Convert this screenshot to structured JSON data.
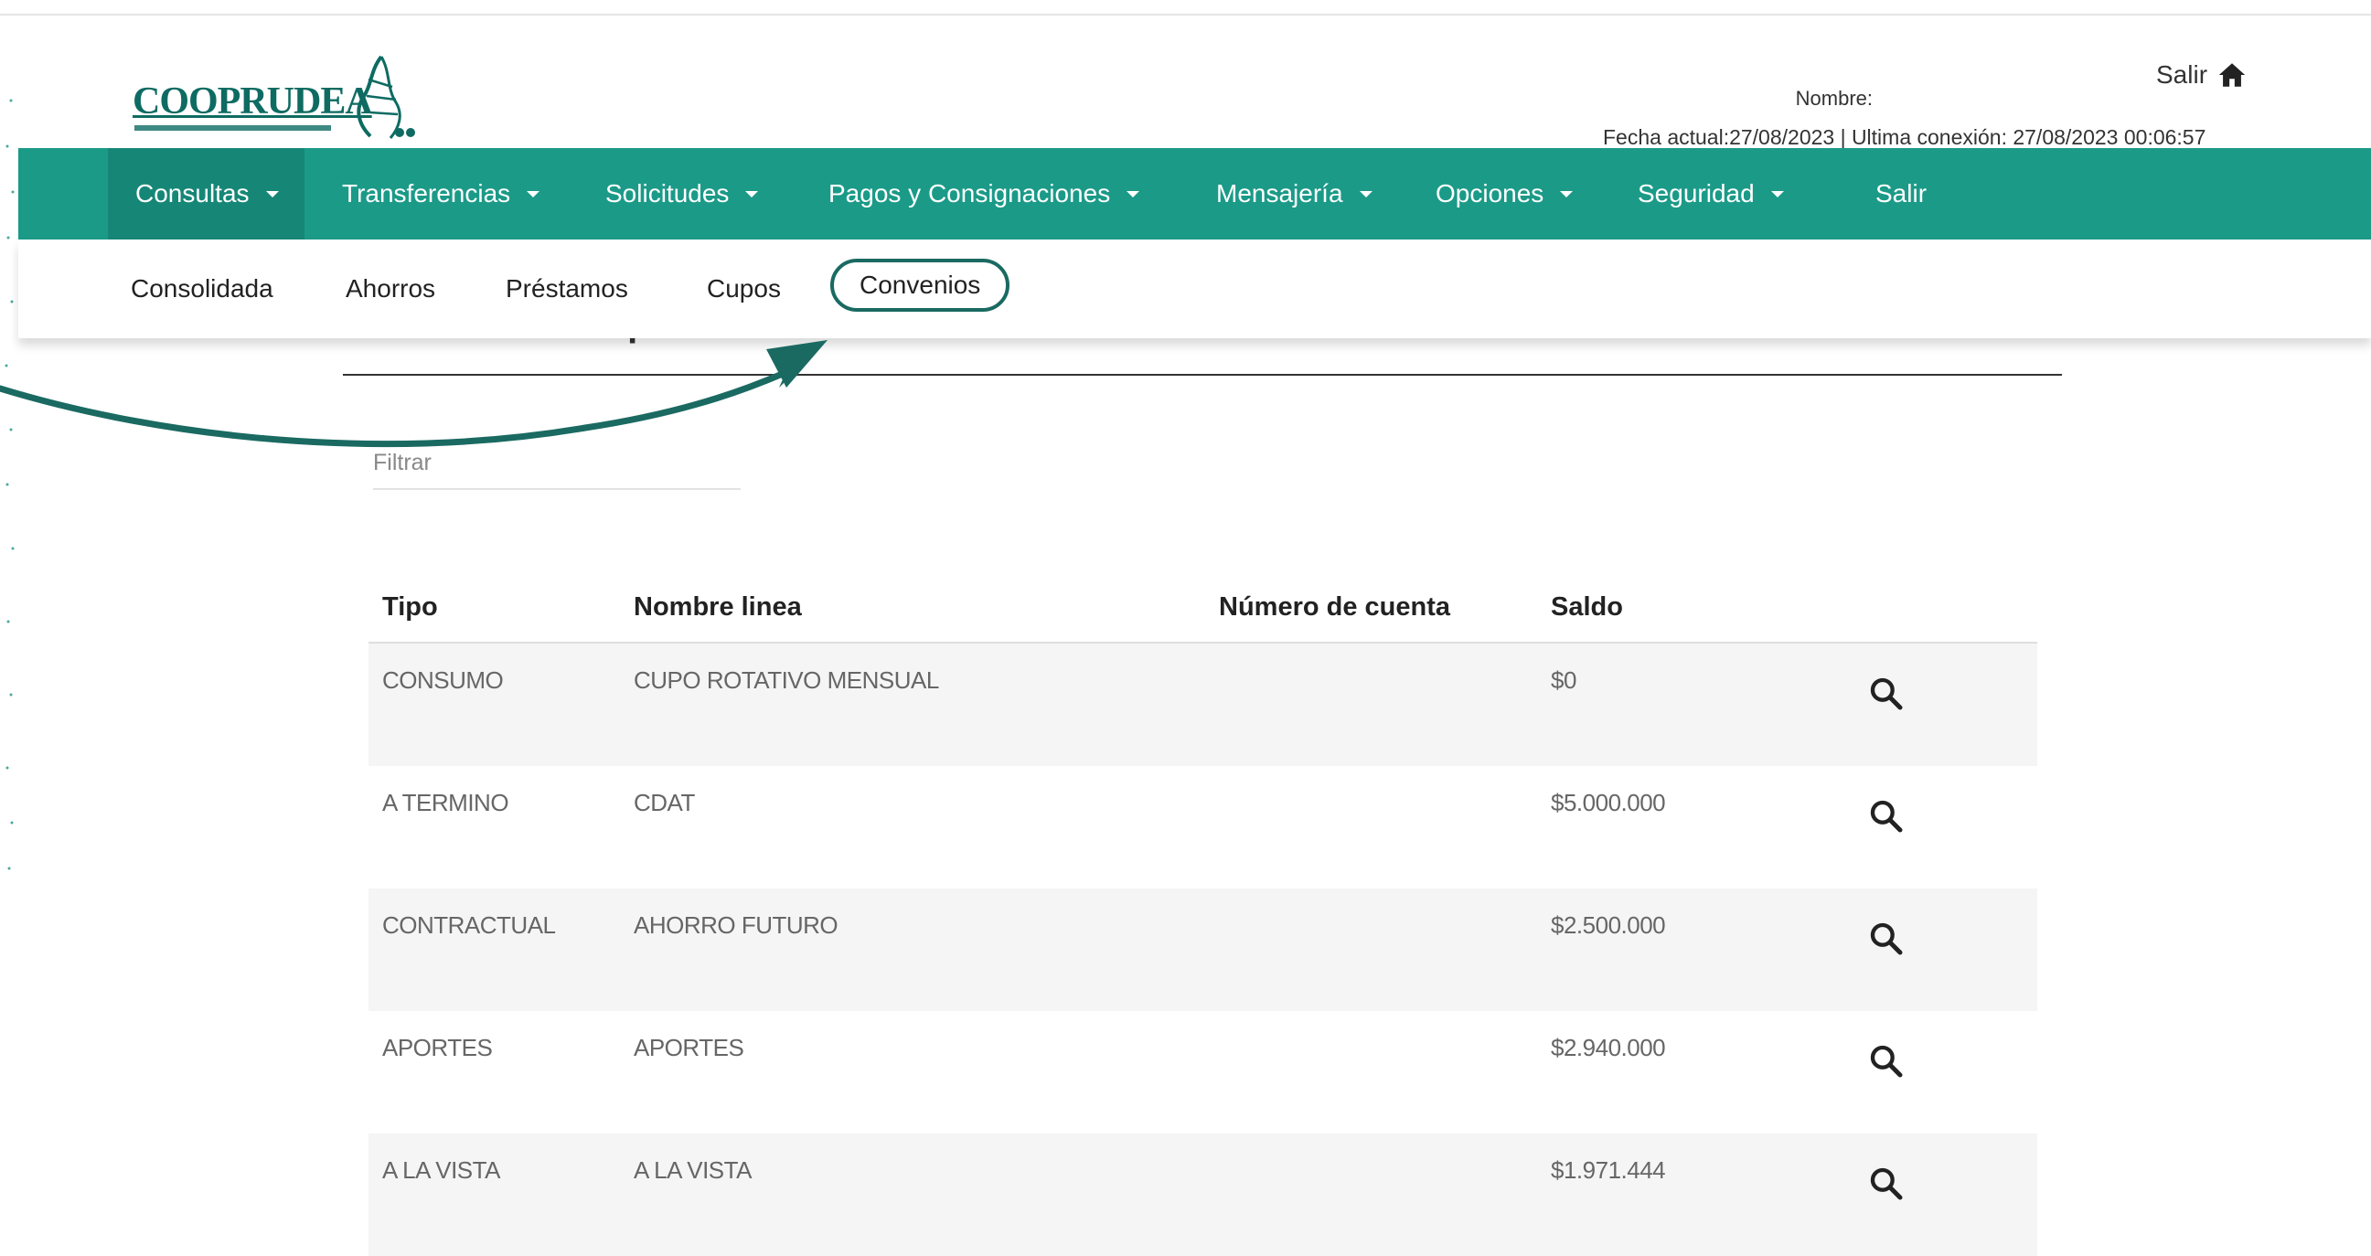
{
  "header": {
    "logo_text": "COOPRUDEA",
    "salir_label": "Salir",
    "user_name": "Nombre:",
    "user_info": "Fecha actual:27/08/2023 | Ultima conexión: 27/08/2023 00:06:57"
  },
  "nav": {
    "items": [
      {
        "label": "Consultas"
      },
      {
        "label": "Transferencias"
      },
      {
        "label": "Solicitudes"
      },
      {
        "label": "Pagos y Consignaciones"
      },
      {
        "label": "Mensajería"
      },
      {
        "label": "Opciones"
      },
      {
        "label": "Seguridad"
      },
      {
        "label": "Salir"
      }
    ]
  },
  "subnav": {
    "items": [
      {
        "label": "Consolidada"
      },
      {
        "label": "Ahorros"
      },
      {
        "label": "Préstamos"
      },
      {
        "label": "Cupos"
      },
      {
        "label": "Convenios"
      }
    ]
  },
  "page": {
    "title": "Consolidado de productos"
  },
  "filter": {
    "placeholder": "Filtrar"
  },
  "table": {
    "headers": [
      "Tipo",
      "Nombre linea",
      "Número de cuenta",
      "Saldo"
    ],
    "rows": [
      {
        "tipo": "CONSUMO",
        "nombre": "CUPO ROTATIVO MENSUAL",
        "cuenta": "",
        "saldo": "$0"
      },
      {
        "tipo": "A TERMINO",
        "nombre": "CDAT",
        "cuenta": "",
        "saldo": "$5.000.000"
      },
      {
        "tipo": "CONTRACTUAL",
        "nombre": "AHORRO FUTURO",
        "cuenta": "",
        "saldo": "$2.500.000"
      },
      {
        "tipo": "APORTES",
        "nombre": "APORTES",
        "cuenta": "",
        "saldo": "$2.940.000"
      },
      {
        "tipo": "A LA VISTA",
        "nombre": "A LA VISTA",
        "cuenta": "",
        "saldo": "$1.971.444"
      }
    ]
  },
  "colors": {
    "brand": "#1b9a88",
    "brand_dark": "#0e6b62",
    "highlight": "#1a6a62"
  }
}
